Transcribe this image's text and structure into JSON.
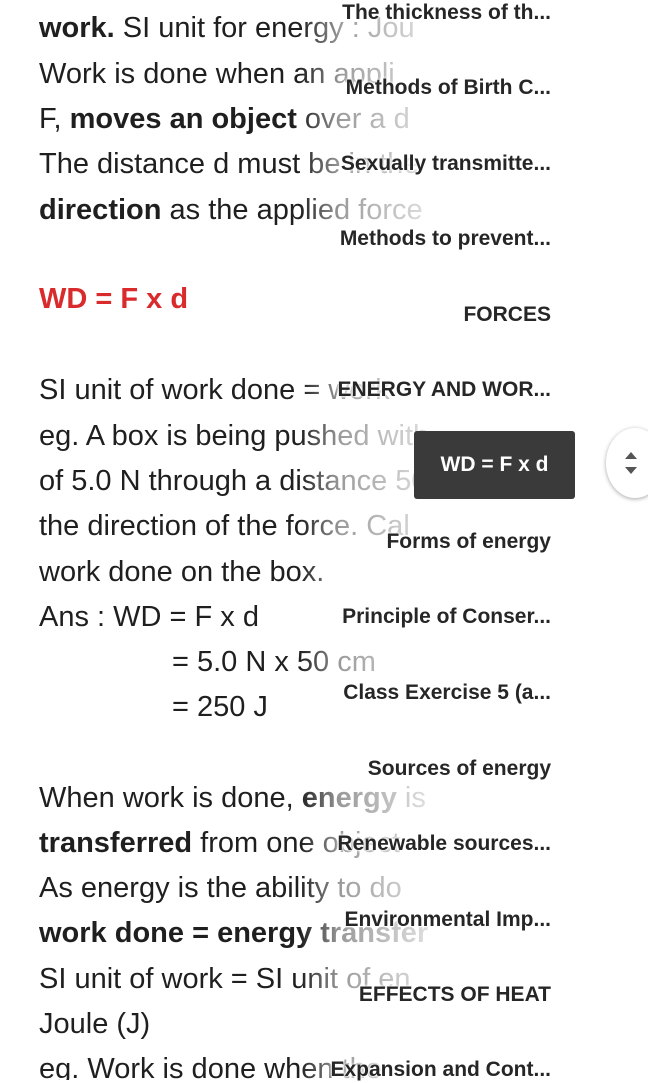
{
  "note": {
    "lines": [
      {
        "a": "work.",
        "b": " SI unit for energy : Jou"
      },
      {
        "a": "Work is done when an appli"
      },
      {
        "a": "F, ",
        "b": "moves an object",
        "c": " over a d"
      },
      {
        "a": "The distance d must be in the"
      },
      {
        "a": "direction",
        "b": " as the applied force"
      },
      {
        "a": "WD = F x d"
      },
      {
        "a": "SI unit of work done = work"
      },
      {
        "a": "eg. A box is being pushed with"
      },
      {
        "a": "of 5.0 N through a distance 50"
      },
      {
        "a": "the direction of the force. Cal"
      },
      {
        "a": "work done on the box."
      },
      {
        "a": "Ans : WD = F x d"
      },
      {
        "a": "= 5.0 N x 50 cm"
      },
      {
        "a": "= 250 J"
      },
      {
        "a": "When work is done, ",
        "b": "energy",
        "c": " is"
      },
      {
        "a": "transferred",
        "b": " from one object"
      },
      {
        "a": "As energy is the ability to do"
      },
      {
        "a": "work done = energy transfer"
      },
      {
        "a": "SI unit of work = SI unit of en"
      },
      {
        "a": "Joule (J)"
      },
      {
        "a": "eg. Work is done when the"
      }
    ]
  },
  "toc": {
    "items": [
      "The thickness of th...",
      "Methods of Birth C...",
      "Sexually transmitte...",
      "Methods to prevent...",
      "FORCES",
      "ENERGY AND WOR...",
      "Forms of energy",
      "Principle of Conser...",
      "Class Exercise 5 (a...",
      "Sources of energy",
      "Renewable sources...",
      "Environmental Imp...",
      "EFFECTS OF HEAT",
      "Expansion and Cont..."
    ],
    "active": "WD = F x d"
  },
  "colors": {
    "highlight": "#d92b2b",
    "active_bg": "#3a3a3a"
  },
  "scroll_icon": "up-down-chevron-icon"
}
